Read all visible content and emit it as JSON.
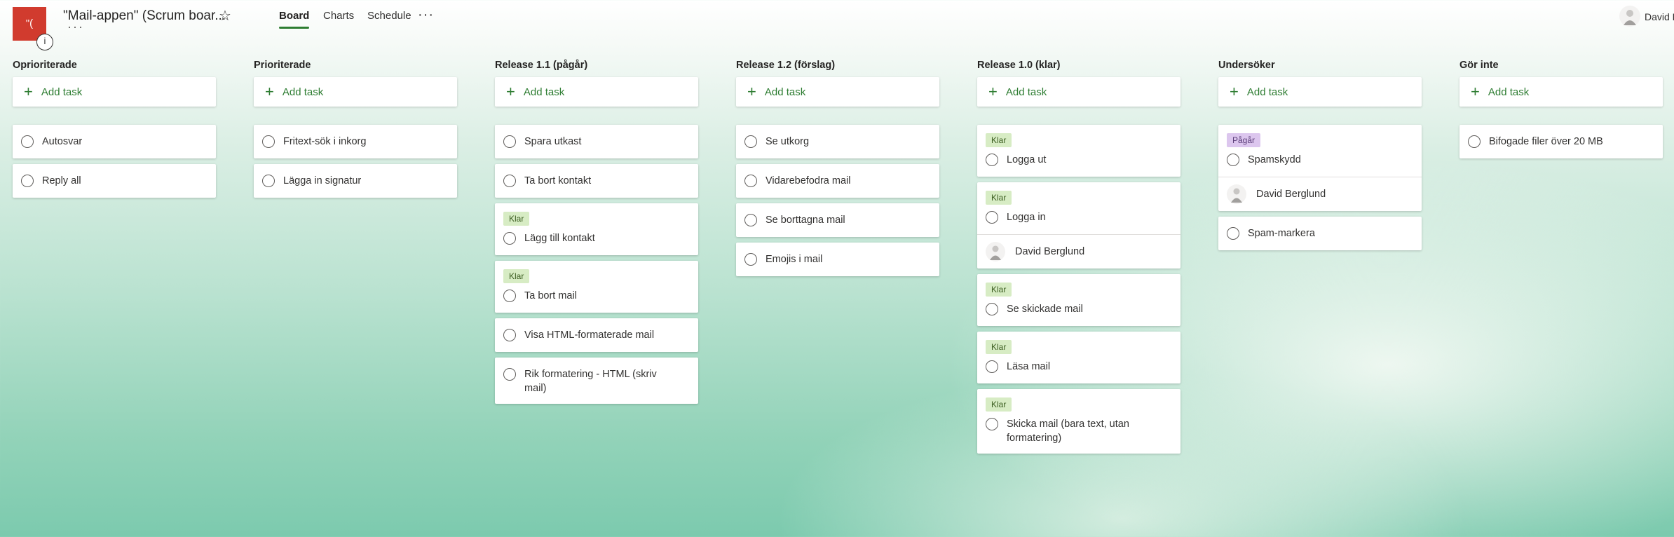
{
  "header": {
    "logo_text": "\"(",
    "logo_badge": "i",
    "plan_title": "\"Mail-appen\" (Scrum boar...",
    "title_more": "···",
    "tabs": [
      "Board",
      "Charts",
      "Schedule"
    ],
    "active_tab": "Board",
    "more_label": "···",
    "user_name": "David B"
  },
  "add_task_label": "Add task",
  "columns": [
    {
      "title": "Oprioriterade",
      "tasks": [
        {
          "title": "Autosvar"
        },
        {
          "title": "Reply all"
        }
      ]
    },
    {
      "title": "Prioriterade",
      "tasks": [
        {
          "title": "Fritext-sök i inkorg"
        },
        {
          "title": "Lägga in signatur"
        }
      ]
    },
    {
      "title": "Release 1.1 (pågår)",
      "tasks": [
        {
          "title": "Spara utkast"
        },
        {
          "title": "Ta bort kontakt"
        },
        {
          "title": "Lägg till kontakt",
          "label": "Klar"
        },
        {
          "title": "Ta bort mail",
          "label": "Klar"
        },
        {
          "title": "Visa HTML-formaterade mail"
        },
        {
          "title": "Rik formatering - HTML (skriv mail)"
        }
      ]
    },
    {
      "title": "Release 1.2 (förslag)",
      "tasks": [
        {
          "title": "Se utkorg"
        },
        {
          "title": "Vidarebefodra mail"
        },
        {
          "title": "Se borttagna mail"
        },
        {
          "title": "Emojis i mail"
        }
      ]
    },
    {
      "title": "Release 1.0 (klar)",
      "tasks": [
        {
          "title": "Logga ut",
          "label": "Klar"
        },
        {
          "title": "Logga in",
          "label": "Klar",
          "assignee": "David Berglund"
        },
        {
          "title": "Se skickade mail",
          "label": "Klar"
        },
        {
          "title": "Läsa mail",
          "label": "Klar"
        },
        {
          "title": "Skicka mail (bara text, utan formatering)",
          "label": "Klar"
        }
      ]
    },
    {
      "title": "Undersöker",
      "tasks": [
        {
          "title": "Spamskydd",
          "label": "Pågår",
          "assignee": "David Berglund"
        },
        {
          "title": "Spam-markera"
        }
      ]
    },
    {
      "title": "Gör inte",
      "tasks": [
        {
          "title": "Bifogade filer över 20 MB"
        }
      ]
    }
  ],
  "colors": {
    "accent": "#2e7d32",
    "logo_bg": "#d13b2e",
    "label_klar_bg": "#d7ecc4",
    "label_pagar_bg": "#dcc6ee"
  }
}
